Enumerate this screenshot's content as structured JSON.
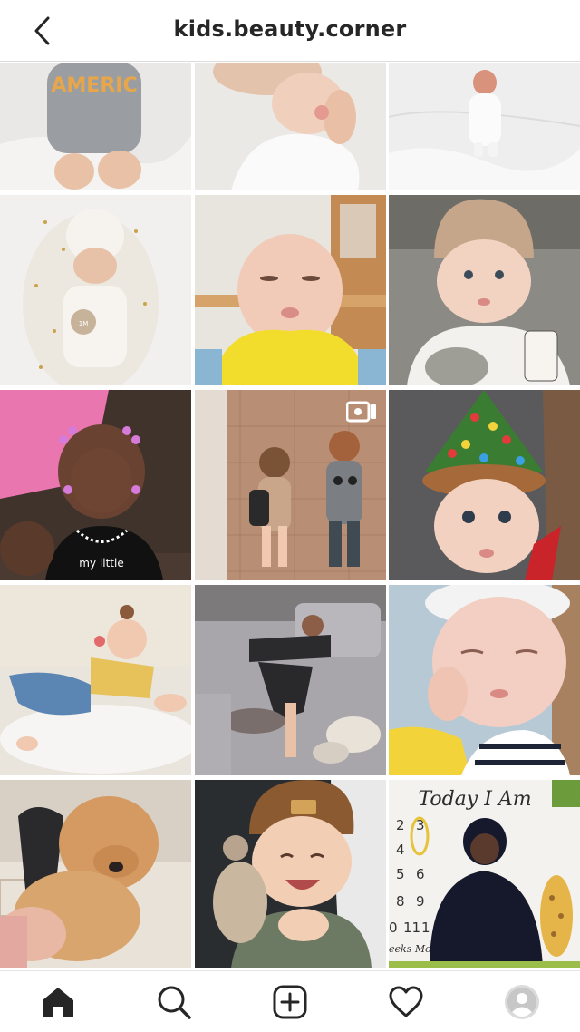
{
  "header": {
    "username": "kids.beauty.corner",
    "back_icon": "chevron-left-icon"
  },
  "grid": {
    "posts": [
      {
        "name": "post-onesie-baby",
        "subject": "baby in america onesie",
        "type": "photo"
      },
      {
        "name": "post-mother-newborn",
        "subject": "mother with newborn",
        "type": "photo"
      },
      {
        "name": "post-newborn-crying-bed",
        "subject": "crying newborn on bed",
        "type": "photo"
      },
      {
        "name": "post-baby-bunny-hat",
        "subject": "baby in bunny hat",
        "type": "photo"
      },
      {
        "name": "post-baby-pouting-highchair",
        "subject": "pouting baby in high chair",
        "type": "photo"
      },
      {
        "name": "post-baby-knit-hat",
        "subject": "baby in knit hat",
        "type": "photo"
      },
      {
        "name": "post-baby-pink-beads",
        "subject": "baby with pink beads",
        "type": "photo"
      },
      {
        "name": "post-toddlers-holding-hands",
        "subject": "toddlers holding hands",
        "type": "video"
      },
      {
        "name": "post-baby-christmas-hat",
        "subject": "baby in christmas tree hat",
        "type": "photo"
      },
      {
        "name": "post-baby-pacifier-chair",
        "subject": "baby with pacifier on chair",
        "type": "photo"
      },
      {
        "name": "post-mom-sleeping-sofa",
        "subject": "mom sleeping on sofa with cat",
        "type": "photo"
      },
      {
        "name": "post-baby-sleeping",
        "subject": "sleeping baby",
        "type": "photo"
      },
      {
        "name": "post-chow-chow-dog",
        "subject": "chow chow dog with woman",
        "type": "photo"
      },
      {
        "name": "post-baby-carhartt-hat",
        "subject": "smiling baby in beanie",
        "type": "photo"
      },
      {
        "name": "post-today-i-am-blanket",
        "subject": "today i am milestone blanket",
        "type": "photo",
        "blanket_title": "Today I Am"
      }
    ],
    "blanket_numbers": [
      "2",
      "3",
      "4",
      "5",
      "6",
      "8",
      "9",
      "0",
      "11",
      "1"
    ],
    "blanket_footer": "eeks Mon"
  },
  "tabbar": {
    "tabs": [
      {
        "name": "tab-home",
        "icon": "home-icon"
      },
      {
        "name": "tab-search",
        "icon": "search-icon"
      },
      {
        "name": "tab-new-post",
        "icon": "plus-square-icon"
      },
      {
        "name": "tab-activity",
        "icon": "heart-icon"
      },
      {
        "name": "tab-profile",
        "icon": "profile-avatar-icon"
      }
    ]
  }
}
